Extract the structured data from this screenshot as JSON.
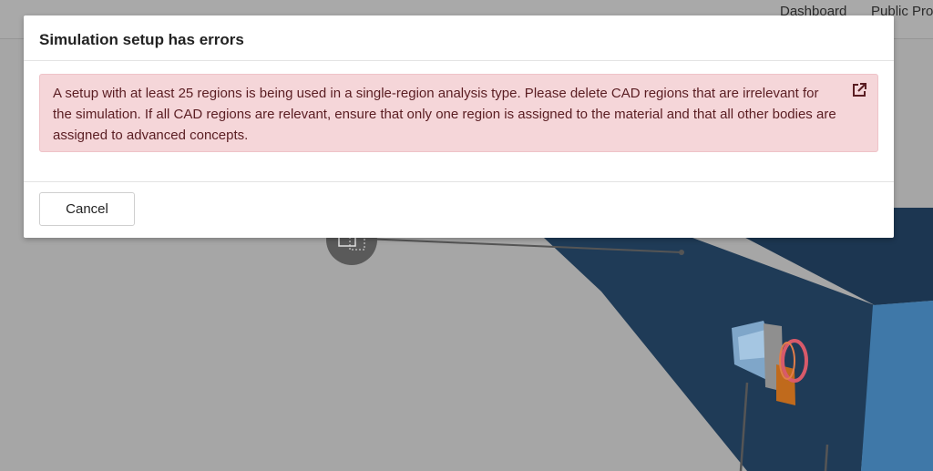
{
  "nav": {
    "dashboard": "Dashboard",
    "public": "Public Pro"
  },
  "dialog": {
    "title": "Simulation setup has errors",
    "error_message": "A setup with at least 25 regions is being used in a single-region analysis type. Please delete CAD regions that are irrelevant for the simulation. If all CAD regions are relevant, ensure that only one region is assigned to the material and that all other bodies are assigned to advanced concepts.",
    "error_link_icon": "external-link-icon",
    "cancel_label": "Cancel"
  },
  "colors": {
    "overlay": "#a6a6a6",
    "alert_background": "#f5d6d9",
    "alert_border": "#efc3c8",
    "alert_text": "#5a1d22",
    "model_dark": "#1d3a55",
    "model_light": "#3f78a8"
  }
}
